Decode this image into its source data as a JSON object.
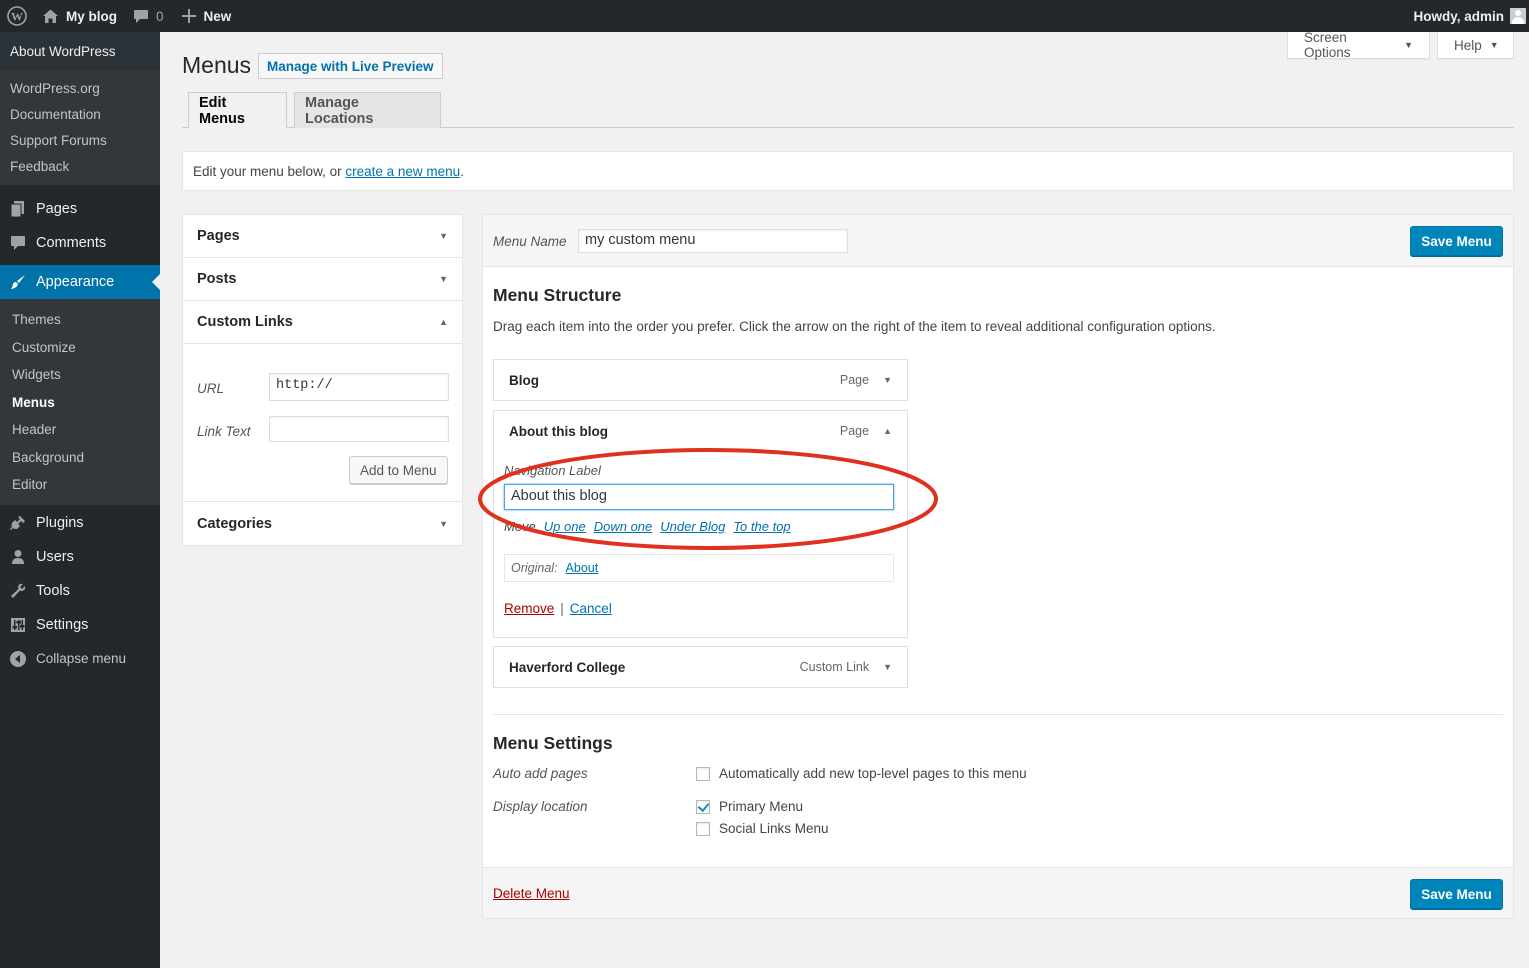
{
  "admin_bar": {
    "site_name": "My blog",
    "comments_count": "0",
    "new_label": "New",
    "greeting": "Howdy, admin"
  },
  "sidebar": {
    "about_label": "About WordPress",
    "wp_links": [
      "WordPress.org",
      "Documentation",
      "Support Forums",
      "Feedback"
    ],
    "pages": "Pages",
    "comments": "Comments",
    "appearance": "Appearance",
    "appearance_items": [
      "Themes",
      "Customize",
      "Widgets",
      "Menus",
      "Header",
      "Background",
      "Editor"
    ],
    "plugins": "Plugins",
    "users": "Users",
    "tools": "Tools",
    "settings": "Settings",
    "collapse": "Collapse menu"
  },
  "header": {
    "title": "Menus",
    "live_preview": "Manage with Live Preview",
    "screen_options": "Screen Options",
    "help": "Help"
  },
  "tabs": [
    "Edit Menus",
    "Manage Locations"
  ],
  "notice": {
    "text": "Edit your menu below, or",
    "link": "create a new menu",
    "end": "."
  },
  "accordion": {
    "pages": "Pages",
    "posts": "Posts",
    "custom_links": "Custom Links",
    "url_label": "URL",
    "url_value": "http://",
    "link_text_label": "Link Text",
    "link_text_value": "",
    "add_button": "Add to Menu",
    "categories": "Categories"
  },
  "menu": {
    "name_label": "Menu Name",
    "name_value": "my custom menu",
    "save_button": "Save Menu",
    "structure_title": "Menu Structure",
    "structure_desc": "Drag each item into the order you prefer. Click the arrow on the right of the item to reveal additional configuration options.",
    "items": [
      {
        "title": "Blog",
        "type": "Page"
      },
      {
        "title": "About this blog",
        "type": "Page"
      },
      {
        "title": "Haverford College",
        "type": "Custom Link"
      }
    ],
    "expanded": {
      "nav_label_caption": "Navigation Label",
      "nav_label_value": "About this blog",
      "move_caption": "Move",
      "move_links": [
        "Up one",
        "Down one",
        "Under Blog",
        "To the top"
      ],
      "original_caption": "Original:",
      "original_link": "About",
      "remove": "Remove",
      "separator": "|",
      "cancel": "Cancel"
    },
    "settings_title": "Menu Settings",
    "auto_add_label": "Auto add pages",
    "auto_add_option": "Automatically add new top-level pages to this menu",
    "auto_add_checked": false,
    "display_location_label": "Display location",
    "locations": [
      {
        "label": "Primary Menu",
        "checked": true
      },
      {
        "label": "Social Links Menu",
        "checked": false
      }
    ],
    "delete_link": "Delete Menu"
  },
  "colors": {
    "admin_dark": "#23282d",
    "accent_blue": "#0073aa",
    "primary_button": "#0085ba",
    "annotation_red": "#e0301e",
    "delete_red": "#aa0000"
  }
}
